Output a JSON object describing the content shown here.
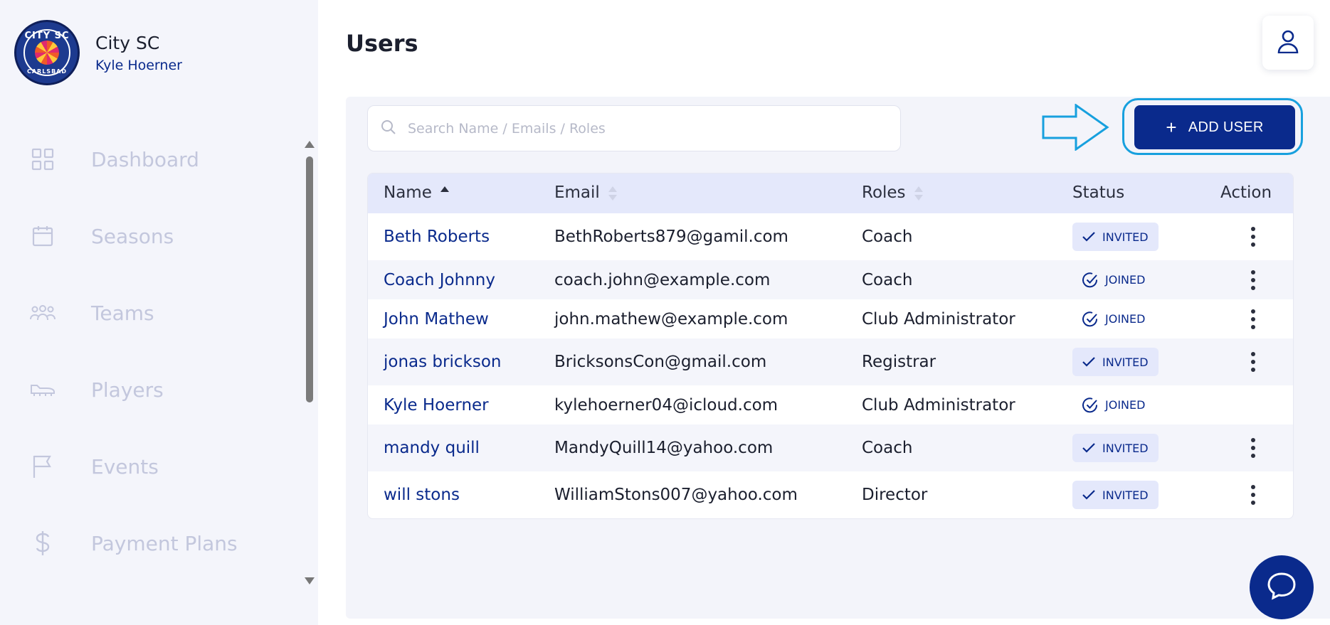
{
  "org": {
    "name": "City SC",
    "user": "Kyle Hoerner",
    "logo_top_text": "CITY SC",
    "logo_bottom_text": "CARLSBAD"
  },
  "nav": {
    "items": [
      {
        "label": "Dashboard",
        "icon": "grid-icon"
      },
      {
        "label": "Seasons",
        "icon": "calendar-icon"
      },
      {
        "label": "Teams",
        "icon": "people-icon"
      },
      {
        "label": "Players",
        "icon": "cleat-icon"
      },
      {
        "label": "Events",
        "icon": "flag-icon"
      },
      {
        "label": "Payment Plans",
        "icon": "dollar-icon"
      }
    ]
  },
  "page": {
    "title": "Users"
  },
  "search": {
    "placeholder": "Search Name / Emails / Roles",
    "value": ""
  },
  "toolbar": {
    "add_user_label": "ADD USER",
    "add_user_icon": "plus"
  },
  "table": {
    "headers": {
      "name": "Name",
      "email": "Email",
      "roles": "Roles",
      "status": "Status",
      "action": "Action"
    },
    "rows": [
      {
        "name": "Beth Roberts",
        "email": "BethRoberts879@gamil.com",
        "role": "Coach",
        "status": "INVITED",
        "has_action": true
      },
      {
        "name": "Coach Johnny",
        "email": "coach.john@example.com",
        "role": "Coach",
        "status": "JOINED",
        "has_action": true
      },
      {
        "name": "John Mathew",
        "email": "john.mathew@example.com",
        "role": "Club Administrator",
        "status": "JOINED",
        "has_action": true
      },
      {
        "name": "jonas brickson",
        "email": "BricksonsCon@gmail.com",
        "role": "Registrar",
        "status": "INVITED",
        "has_action": true
      },
      {
        "name": "Kyle Hoerner",
        "email": "kylehoerner04@icloud.com",
        "role": "Club Administrator",
        "status": "JOINED",
        "has_action": false
      },
      {
        "name": "mandy quill",
        "email": "MandyQuill14@yahoo.com",
        "role": "Coach",
        "status": "INVITED",
        "has_action": true
      },
      {
        "name": "will stons",
        "email": "WilliamStons007@yahoo.com",
        "role": "Director",
        "status": "INVITED",
        "has_action": true
      }
    ]
  },
  "colors": {
    "brand": "#0a2a8c",
    "highlight": "#17a0de",
    "nav_inactive": "#c3c7dd",
    "sidebar_bg": "#f4f5fb",
    "header_bg": "#e4e8fb"
  }
}
